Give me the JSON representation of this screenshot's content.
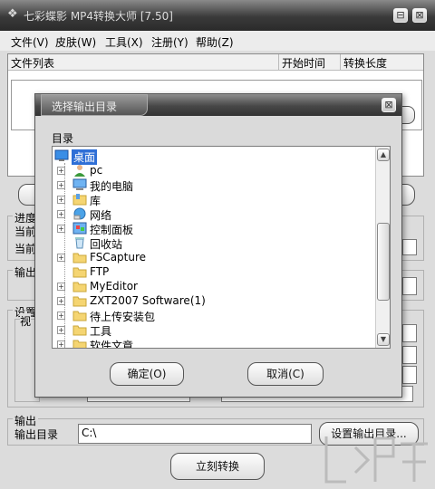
{
  "app": {
    "title": "七彩蝶影 MP4转换大师 [7.50]",
    "minimize": "⊟",
    "close": "⊠"
  },
  "menu": [
    "文件(V)",
    "皮肤(W)",
    "工具(X)",
    "注册(Y)",
    "帮助(Z)"
  ],
  "filelist": {
    "label": "文件列表",
    "col_start": "开始时间",
    "col_length": "转换长度"
  },
  "main": {
    "progress_label": "进度",
    "current_label_1": "当前",
    "current_label_2": "当前",
    "output_label_partial": "输出",
    "settings_label": "设置",
    "video_label": "视"
  },
  "bottom": {
    "output_group": "输出",
    "output_dir_label": "输出目录",
    "output_dir_value": "C:\\",
    "set_output_button": "设置输出目录...",
    "convert_button": "立刻转换"
  },
  "dialog": {
    "title": "选择输出目录",
    "close": "⊠",
    "dir_label": "目录",
    "items": [
      {
        "label": "桌面",
        "icon": "desktop-icon",
        "expander": false,
        "selected": true
      },
      {
        "label": "pc",
        "icon": "user-icon",
        "expander": true
      },
      {
        "label": "我的电脑",
        "icon": "computer-icon",
        "expander": true
      },
      {
        "label": "库",
        "icon": "library-icon",
        "expander": true
      },
      {
        "label": "网络",
        "icon": "network-icon",
        "expander": true
      },
      {
        "label": "控制面板",
        "icon": "control-panel-icon",
        "expander": true
      },
      {
        "label": "回收站",
        "icon": "recycle-bin-icon",
        "expander": false
      },
      {
        "label": "FSCapture",
        "icon": "folder-icon",
        "expander": true
      },
      {
        "label": "FTP",
        "icon": "folder-icon",
        "expander": false
      },
      {
        "label": "MyEditor",
        "icon": "folder-icon",
        "expander": true
      },
      {
        "label": "ZXT2007 Software(1)",
        "icon": "folder-icon",
        "expander": true
      },
      {
        "label": "待上传安装包",
        "icon": "folder-icon",
        "expander": true
      },
      {
        "label": "工具",
        "icon": "folder-icon",
        "expander": true
      },
      {
        "label": "软件文章",
        "icon": "folder-icon",
        "expander": true
      }
    ],
    "ok_button": "确定(O)",
    "cancel_button": "取消(C)"
  },
  "colors": {
    "folder": "#f5d572",
    "selection": "#2f6fd6",
    "titlebar_dark": "#333333"
  }
}
